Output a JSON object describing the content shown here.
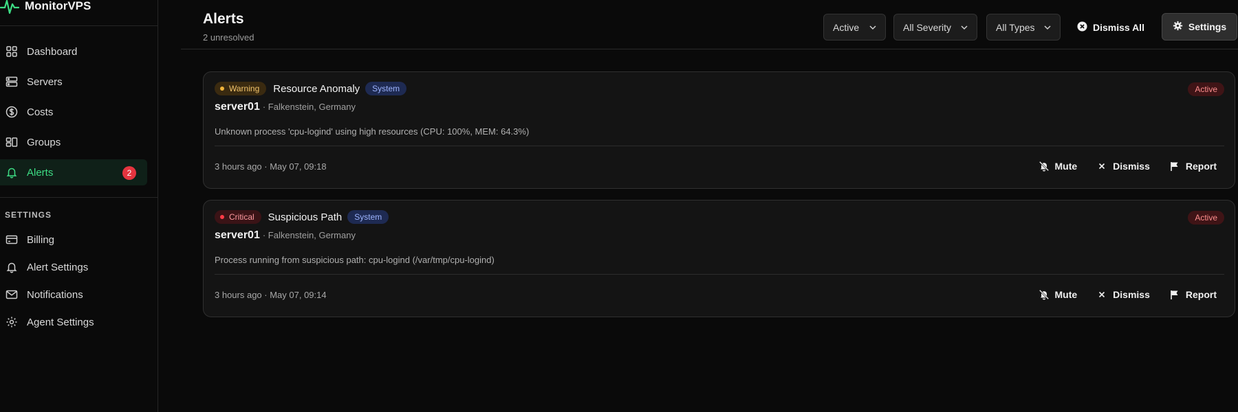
{
  "app": {
    "name": "MonitorVPS"
  },
  "sidebar": {
    "nav": [
      {
        "label": "Dashboard",
        "icon": "grid-icon"
      },
      {
        "label": "Servers",
        "icon": "server-icon"
      },
      {
        "label": "Costs",
        "icon": "dollar-icon"
      },
      {
        "label": "Groups",
        "icon": "groups-icon"
      },
      {
        "label": "Alerts",
        "icon": "bell-icon",
        "badge": "2",
        "active": true
      }
    ],
    "settings_heading": "SETTINGS",
    "settings": [
      {
        "label": "Billing",
        "icon": "credit-card-icon"
      },
      {
        "label": "Alert Settings",
        "icon": "bell-icon"
      },
      {
        "label": "Notifications",
        "icon": "mail-icon"
      },
      {
        "label": "Agent Settings",
        "icon": "gear-icon"
      }
    ]
  },
  "header": {
    "title": "Alerts",
    "subtitle": "2 unresolved",
    "filters": {
      "status": "Active",
      "severity": "All Severity",
      "type": "All Types"
    },
    "dismiss_all": "Dismiss All",
    "settings": "Settings"
  },
  "alerts": [
    {
      "severity": "Warning",
      "title": "Resource Anomaly",
      "type": "System",
      "status": "Active",
      "server": "server01",
      "location": "· Falkenstein, Germany",
      "message": "Unknown process 'cpu-logind' using high resources (CPU: 100%, MEM: 64.3%)",
      "time": "3 hours ago · May 07, 09:18"
    },
    {
      "severity": "Critical",
      "title": "Suspicious Path",
      "type": "System",
      "status": "Active",
      "server": "server01",
      "location": "· Falkenstein, Germany",
      "message": "Process running from suspicious path: cpu-logind (/var/tmp/cpu-logind)",
      "time": "3 hours ago · May 07, 09:14"
    }
  ],
  "actions": {
    "mute": "Mute",
    "dismiss": "Dismiss",
    "report": "Report"
  },
  "colors": {
    "accent": "#3ddc84",
    "badge": "#e5343f",
    "warning": "#f0b43a",
    "critical": "#ff3b47",
    "type_tag": "#9db4ff"
  }
}
